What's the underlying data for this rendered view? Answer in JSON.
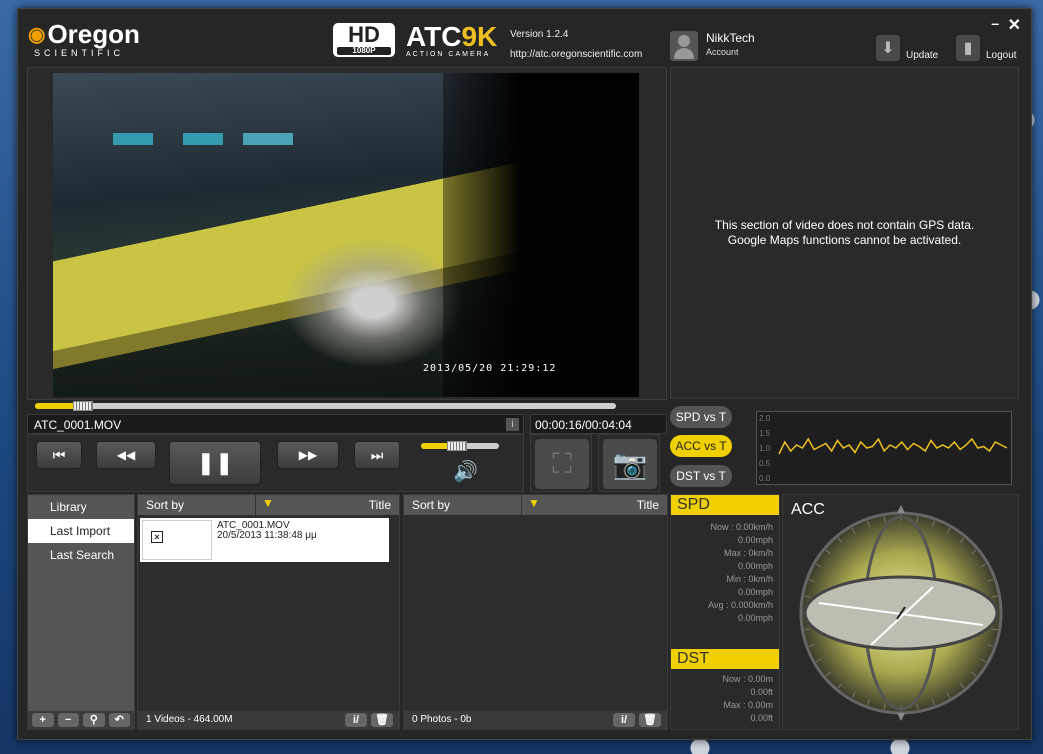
{
  "header": {
    "brand": "Oregon",
    "brand_sub": "SCIENTIFIC",
    "hd_label": "HD",
    "hd_res": "1080P",
    "product": "ATC",
    "product_k": "9K",
    "product_sub": "ACTION CAMERA",
    "version": "Version 1.2.4",
    "url": "http://atc.oregonscientific.com",
    "user_name": "NikkTech",
    "user_role": "Account",
    "update_label": "Update",
    "logout_label": "Logout",
    "minimize_label": "–",
    "close_label": "✕"
  },
  "player": {
    "timestamp": "2013/05/20  21:29:12",
    "progress_fraction": 0.09,
    "filename": "ATC_0001.MOV",
    "info_icon": "i",
    "current_time": "00:00:16",
    "separator": "/",
    "total_time": "00:04:04",
    "volume_fraction": 0.46,
    "buttons": {
      "prev": "⏮",
      "rewind": "◀◀",
      "pause": "❚❚",
      "forward": "▶▶",
      "next": "⏭"
    }
  },
  "map": {
    "line1": "This section of video does not contain GPS data.",
    "line2": "Google Maps functions cannot be activated."
  },
  "graph_buttons": {
    "spd": "SPD vs T",
    "acc": "ACC vs T",
    "dst": "DST vs T"
  },
  "chart_data": {
    "type": "line",
    "series": [
      {
        "values": [
          0.8,
          1.2,
          0.9,
          1.1,
          1.0,
          1.3,
          0.95,
          1.05,
          1.15,
          0.9,
          1.25,
          1.0,
          1.1,
          0.85,
          1.2,
          1.0,
          1.05,
          1.3,
          0.9,
          1.1,
          1.0,
          1.2,
          0.95,
          1.15,
          1.05,
          0.9,
          1.25,
          1.0,
          1.1,
          1.0,
          1.2,
          0.95,
          1.1,
          1.3,
          1.0,
          1.05,
          0.9,
          1.2,
          1.1,
          1.0
        ]
      }
    ],
    "ylim": [
      0.0,
      2.0
    ],
    "yticks": [
      "2.0",
      "1.5",
      "1.0",
      "0.5",
      "0.0"
    ]
  },
  "library": {
    "items": [
      "Library",
      "Last Import",
      "Last Search"
    ],
    "selected": 1,
    "footer_buttons": [
      "+",
      "−",
      "⚲",
      "↶"
    ]
  },
  "videos_pane": {
    "sort_label": "Sort by",
    "sort_arrow": "▼",
    "sort_field": "Title",
    "items": [
      {
        "name": "ATC_0001.MOV",
        "date": "20/5/2013 11:38:48 μμ"
      }
    ],
    "footer": "1 Videos - 464.00M"
  },
  "photos_pane": {
    "sort_label": "Sort by",
    "sort_arrow": "▼",
    "sort_field": "Title",
    "footer": "0 Photos - 0b"
  },
  "pane_buttons": {
    "info": "i/",
    "trash": "🗑"
  },
  "spd": {
    "title": "SPD",
    "lines": [
      "Now : 0.00km/h",
      "0.00mph",
      "Max : 0km/h",
      "0.00mph",
      "Min : 0km/h",
      "0.00mph",
      "Avg : 0.000km/h",
      "0.00mph"
    ]
  },
  "dst": {
    "title": "DST",
    "lines": [
      "Now : 0.00m",
      "0.00ft",
      "Max : 0.00m",
      "0.00ft"
    ]
  },
  "acc": {
    "title": "ACC"
  }
}
